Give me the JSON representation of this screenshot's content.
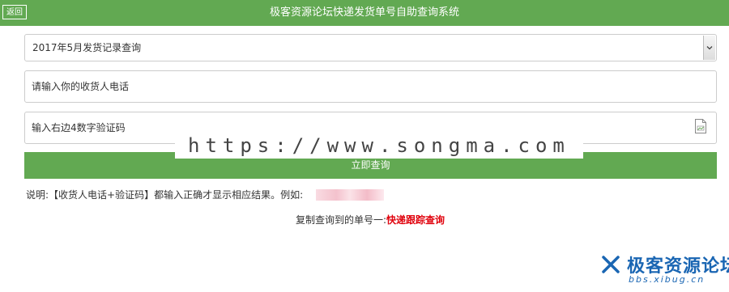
{
  "header": {
    "back_label": "返回",
    "title": "极客资源论坛快递发货单号自助查询系统",
    "background_color": "#62a952"
  },
  "form": {
    "period_select": {
      "selected": "2017年5月发货记录查询"
    },
    "phone_input": {
      "placeholder": "请输入你的收货人电话"
    },
    "code_input": {
      "placeholder": "输入右边4数字验证码"
    },
    "captcha_icon": "broken-image-icon",
    "submit_label": "立即查询"
  },
  "watermark_text": "https://www.songma.com",
  "note": {
    "text": "说明:【收货人电话+验证码】都输入正确才显示相应结果。例如:"
  },
  "copy_hint": {
    "prefix": "复制查询到的单号一:",
    "link_label": "快递跟踪查询",
    "link_color": "#e0000b"
  },
  "logo": {
    "name": "极客资源论坛",
    "url_text": "bbs.xibug.cn",
    "color": "#1a66b3"
  }
}
